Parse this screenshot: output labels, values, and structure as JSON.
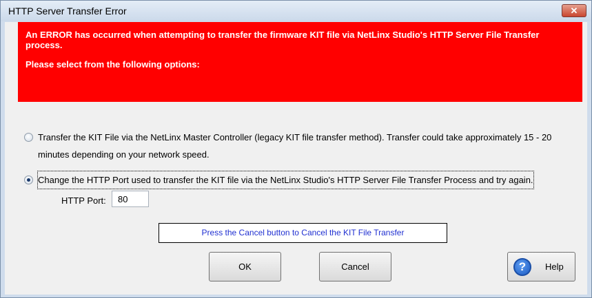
{
  "window": {
    "title": "HTTP Server Transfer Error",
    "close_glyph": "✕"
  },
  "error_banner": {
    "message": "An ERROR has occurred when attempting to transfer the firmware KIT file via NetLinx Studio's HTTP Server File Transfer process.",
    "prompt": "Please select from the following options:",
    "background_color": "#ff0000"
  },
  "options": [
    {
      "line1": "Transfer the KIT File via the NetLinx Master Controller (legacy KIT file transfer method).  Transfer could take approximately 15 - 20",
      "line2": "minutes depending on your network speed.",
      "selected": false
    },
    {
      "line1": "Change the HTTP Port used to transfer the KIT file via the NetLinx Studio's HTTP Server File Transfer Process and try again.",
      "selected": true
    }
  ],
  "http_port": {
    "label": "HTTP Port:",
    "value": "80"
  },
  "status_message": "Press the Cancel button to Cancel the KIT File Transfer",
  "buttons": {
    "ok": "OK",
    "cancel": "Cancel",
    "help": "Help",
    "help_icon_glyph": "?"
  }
}
